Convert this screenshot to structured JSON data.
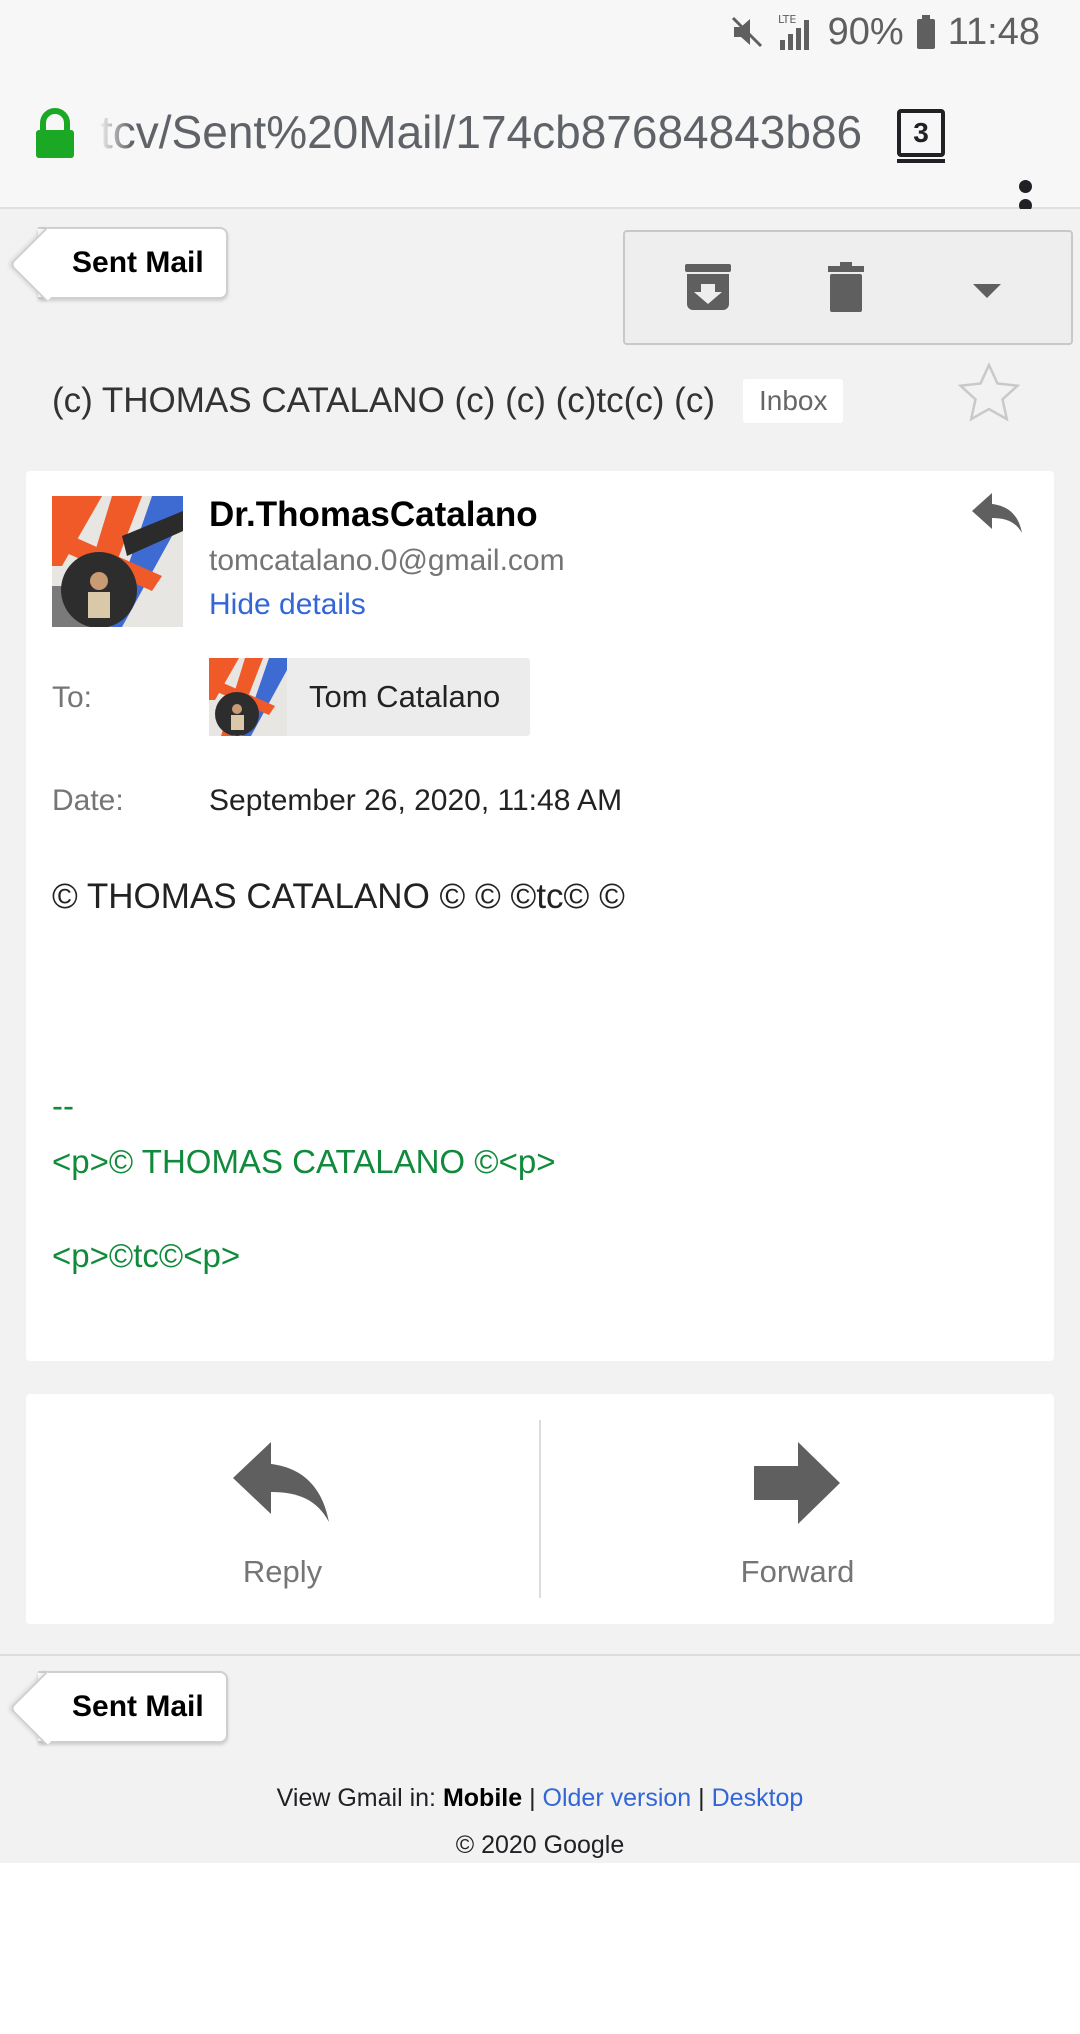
{
  "status_bar": {
    "battery": "90%",
    "time": "11:48",
    "network": "LTE",
    "icons": [
      "mute-icon",
      "signal-icon",
      "battery-icon"
    ]
  },
  "browser": {
    "url": "tcv/Sent%20Mail/174cb87684843b86",
    "tab_count": "3",
    "icons": [
      "lock-icon",
      "tabs-icon",
      "menu-icon"
    ]
  },
  "nav": {
    "back_label": "Sent Mail",
    "bottom_back_label": "Sent Mail"
  },
  "toolbar": {
    "icons": [
      "archive-icon",
      "trash-icon",
      "dropdown-icon"
    ]
  },
  "message": {
    "subject": "(c) THOMAS CATALANO (c) (c) (c)tc(c) (c)",
    "label": "Inbox",
    "sender_name": "Dr.ThomasCatalano",
    "sender_email": "tomcatalano.0@gmail.com",
    "hide_details": "Hide details",
    "to_label": "To:",
    "to_name": "Tom Catalano",
    "date_label": "Date:",
    "date_value": "September 26, 2020, 11:48 AM",
    "body": "© THOMAS CATALANO © © ©tc© ©",
    "sig_dash": "--",
    "sig_line1": "<p>© THOMAS CATALANO ©<p>",
    "sig_line2": "<p>©tc©<p>"
  },
  "actions": {
    "reply": "Reply",
    "forward": "Forward"
  },
  "footer": {
    "view_in": "View Gmail in:",
    "mobile": "Mobile",
    "sep": "|",
    "older": "Older version",
    "desktop": "Desktop",
    "copyright": "© 2020 Google"
  },
  "colors": {
    "link": "#3367d6",
    "signature": "#108a3b",
    "lock": "#1aa825"
  }
}
